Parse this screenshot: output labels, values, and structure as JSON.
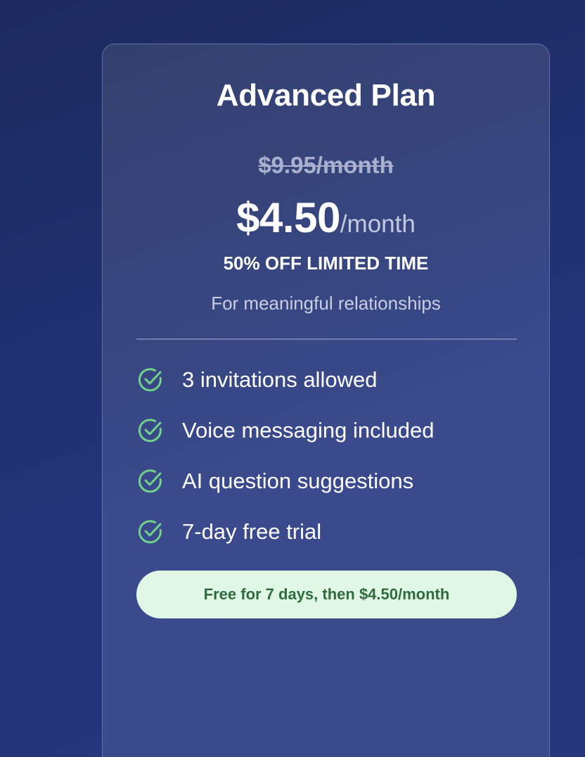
{
  "plan": {
    "title": "Advanced Plan",
    "old_price": "$9.95/month",
    "price_amount": "$4.50",
    "price_unit": "/month",
    "discount_label": "50% OFF LIMITED TIME",
    "subtitle": "For meaningful relationships"
  },
  "features": [
    {
      "label": "3 invitations allowed",
      "icon": "check-circle-icon"
    },
    {
      "label": "Voice messaging included",
      "icon": "check-circle-icon"
    },
    {
      "label": "AI question suggestions",
      "icon": "check-circle-icon"
    },
    {
      "label": "7-day free trial",
      "icon": "check-circle-icon"
    }
  ],
  "cta": {
    "label": "Free for 7 days, then $4.50/month"
  },
  "colors": {
    "background": "#233478",
    "card": "#3a4a8c",
    "check": "#6fd38a",
    "cta_bg": "#e0f7e6",
    "cta_text": "#2f6b3d"
  }
}
